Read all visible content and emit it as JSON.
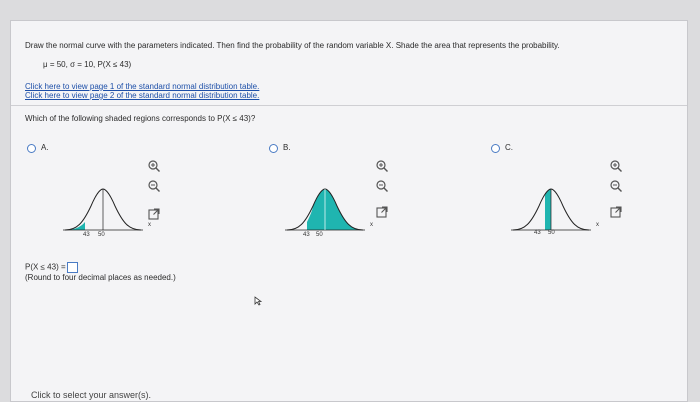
{
  "question": {
    "instruction": "Draw the normal curve with the parameters indicated. Then find the probability of the random variable X. Shade the area that represents the probability.",
    "parameters": "μ = 50, σ = 10, P(X ≤ 43)",
    "links": [
      "Click here to view page 1 of the standard normal distribution table.",
      "Click here to view page 2 of the standard normal distribution table."
    ],
    "prompt": "Which of the following shaded regions corresponds to P(X ≤ 43)?"
  },
  "options": [
    {
      "letter": "A.",
      "shade": "left",
      "tick_labels": [
        "43",
        "50"
      ],
      "axis_label": "x"
    },
    {
      "letter": "B.",
      "shade": "right",
      "tick_labels": [
        "43",
        "50"
      ],
      "axis_label": "x"
    },
    {
      "letter": "C.",
      "shade": "between",
      "tick_labels": [
        "43",
        "50"
      ],
      "axis_label": "x"
    }
  ],
  "answer": {
    "label": "P(X ≤ 43) =",
    "value": "",
    "note": "(Round to four decimal places as needed.)"
  },
  "footer": "Click to select your answer(s).",
  "colors": {
    "shade": "#1fb5b0",
    "link": "#1d4fa8",
    "radio": "#4a7bc4"
  },
  "icons": [
    "zoom-in-icon",
    "zoom-out-icon",
    "popout-icon"
  ]
}
